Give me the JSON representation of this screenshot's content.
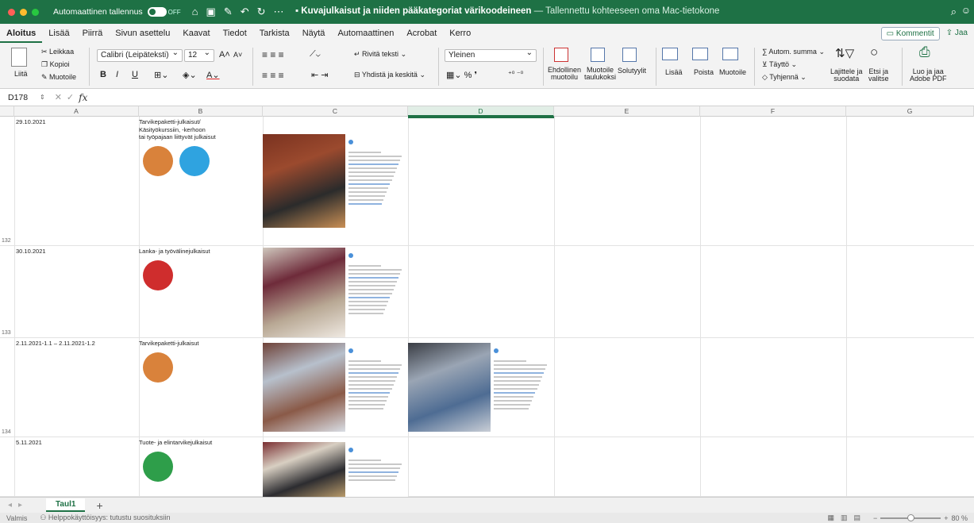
{
  "window": {
    "autosave_label": "Automaattinen tallennus",
    "autosave_state": "OFF",
    "doc_title": "Kuvajulkaisut ja niiden pääkategoriat värikoodeineen",
    "doc_subtitle": " — Tallennettu kohteeseen oma Mac-tietokone"
  },
  "tabs": [
    "Aloitus",
    "Lisää",
    "Piirrä",
    "Sivun asettelu",
    "Kaavat",
    "Tiedot",
    "Tarkista",
    "Näytä",
    "Automaattinen",
    "Acrobat",
    "Kerro"
  ],
  "tabs_right": {
    "comments": "Kommentit",
    "share": "Jaa"
  },
  "ribbon": {
    "paste": "Liitä",
    "cut": "Leikkaa",
    "copy": "Kopioi",
    "format_painter": "Muotoile",
    "font_name": "Calibri (Leipäteksti)",
    "font_size": "12",
    "bold": "B",
    "italic": "I",
    "underline": "U",
    "wrap_text": "Rivitä teksti",
    "merge_center": "Yhdistä ja keskitä",
    "number_format": "Yleinen",
    "conditional_line1": "Ehdollinen",
    "conditional_line2": "muotoilu",
    "format_table_line1": "Muotoile",
    "format_table_line2": "taulukoksi",
    "cell_styles": "Solutyylit",
    "insert": "Lisää",
    "delete": "Poista",
    "format": "Muotoile",
    "autosum": "Autom. summa",
    "fill": "Täyttö",
    "clear": "Tyhjennä",
    "sort_line1": "Lajittele ja",
    "sort_line2": "suodata",
    "find_line1": "Etsi ja",
    "find_line2": "valitse",
    "adobe_line1": "Luo ja jaa",
    "adobe_line2": "Adobe PDF"
  },
  "formula_bar": {
    "name_box": "D178",
    "fx": "fx",
    "value": ""
  },
  "columns": [
    "A",
    "B",
    "C",
    "D",
    "E",
    "F",
    "G"
  ],
  "selected_column": "D",
  "rows": [
    {
      "row_number": "132",
      "date": "29.10.2021",
      "category_lines": [
        "Tarvikepaketti-julkaisut/",
        "Käsityökurssiin, -kerhoon",
        "tai työpajaan liittyvät julkaisut"
      ],
      "colors": [
        "#d9823b",
        "#2fa3e0"
      ]
    },
    {
      "row_number": "133",
      "date": "30.10.2021",
      "category_lines": [
        "Lanka- ja työvälinejulkaisut"
      ],
      "colors": [
        "#cf2d2d"
      ]
    },
    {
      "row_number": "134",
      "date": "2.11.2021-1.1 – 2.11.2021-1.2",
      "category_lines": [
        "Tarvikepaketti-julkaisut"
      ],
      "colors": [
        "#d9823b"
      ]
    },
    {
      "row_number": "",
      "date": "5.11.2021",
      "category_lines": [
        "Tuote- ja elintarvikejulkaisut"
      ],
      "colors": [
        "#2e9e4a"
      ]
    }
  ],
  "sheet": {
    "tab": "Taul1",
    "add": "+"
  },
  "status": {
    "ready": "Valmis",
    "accessibility": "Helppokäyttöisyys: tutustu suosituksiin",
    "zoom": "80 %",
    "zoom_level": 0.5
  },
  "colors": {
    "brand": "#1e7145",
    "ribbon_bg": "#f3f3f3"
  }
}
